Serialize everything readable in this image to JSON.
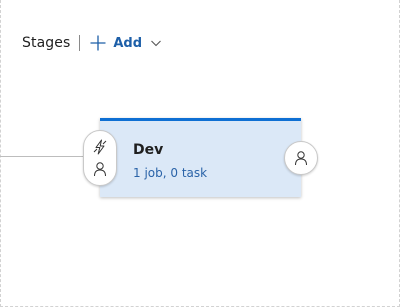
{
  "toolbar": {
    "title": "Stages",
    "add_label": "Add",
    "icons": {
      "add": "plus-icon",
      "dropdown": "chevron-down-icon"
    }
  },
  "stage": {
    "name": "Dev",
    "summary": "1 job, 0 task",
    "accent_color": "#0e6fd3",
    "background_color": "#dbe8f7",
    "pre_deployment_icons": [
      "lightning-trigger-icon",
      "person-approver-icon"
    ],
    "post_deployment_icons": [
      "person-approver-icon"
    ]
  }
}
